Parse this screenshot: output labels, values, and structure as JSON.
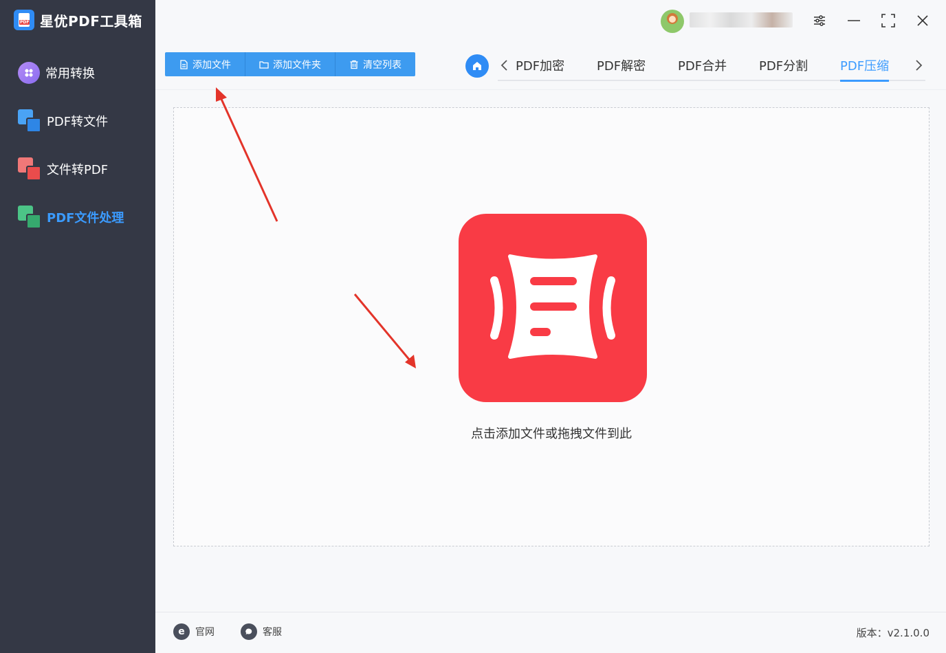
{
  "app": {
    "title": "星优PDF工具箱"
  },
  "sidebar": {
    "items": [
      {
        "label": "常用转换",
        "icon": "grid-circle-icon"
      },
      {
        "label": "PDF转文件",
        "icon": "pdf-to-file-icon"
      },
      {
        "label": "文件转PDF",
        "icon": "file-to-pdf-icon"
      },
      {
        "label": "PDF文件处理",
        "icon": "pdf-process-icon",
        "active": true
      }
    ]
  },
  "toolbar": {
    "add_file": "添加文件",
    "add_folder": "添加文件夹",
    "clear_list": "清空列表"
  },
  "tabs": {
    "items": [
      "PDF加密",
      "PDF解密",
      "PDF合并",
      "PDF分割",
      "PDF压缩"
    ],
    "active": "PDF压缩"
  },
  "dropzone": {
    "hint": "点击添加文件或拖拽文件到此"
  },
  "footer": {
    "website": "官网",
    "support": "客服",
    "version": "版本：v2.1.0.0"
  },
  "colors": {
    "sidebar_bg": "#343845",
    "accent": "#3b9bff",
    "toolbar_bg": "#3d9bf0",
    "compress_icon": "#f93b45"
  }
}
